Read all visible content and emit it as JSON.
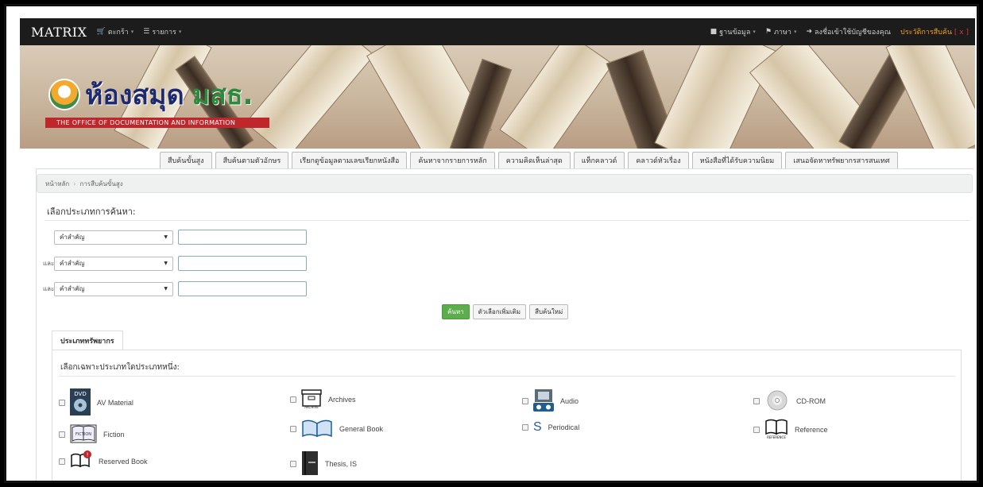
{
  "navbar": {
    "brand": "MATRIX",
    "menu_left": [
      {
        "label": "ตะกร้า",
        "icon": "cart-icon"
      },
      {
        "label": "รายการ",
        "icon": "list-icon"
      }
    ],
    "menu_right": [
      {
        "label": "ฐานข้อมูล",
        "icon": "database-icon"
      },
      {
        "label": "ภาษา",
        "icon": "flag-icon"
      },
      {
        "label": "ลงชื่อเข้าใช้บัญชีของคุณ",
        "icon": "login-icon"
      }
    ],
    "history": {
      "label": "ประวัติการสืบค้น",
      "close": "[ x ]"
    }
  },
  "banner": {
    "logo_thai": "ห้องสมุด",
    "logo_abbr": "มสธ.",
    "logo_sub": "THE OFFICE OF DOCUMENTATION AND INFORMATION"
  },
  "tabs": [
    "สืบค้นขั้นสูง",
    "สืบค้นตามตัวอักษร",
    "เรียกดูข้อมูลตามเลขเรียกหนังสือ",
    "ค้นหาจากรายการหลัก",
    "ความคิดเห็นล่าสุด",
    "แท็กคลาวด์",
    "คลาวด์หัวเรื่อง",
    "หนังสือที่ได้รับความนิยม",
    "เสนอจัดหาทรัพยากรสารสนเทศ"
  ],
  "breadcrumb": {
    "home": "หน้าหลัก",
    "sep": "›",
    "current": "การสืบค้นขั้นสูง"
  },
  "search": {
    "section_title": "เลือกประเภทการค้นหา:",
    "rows": [
      {
        "conj": "",
        "type": "คำสำคัญ",
        "value": ""
      },
      {
        "conj": "และ",
        "type": "คำสำคัญ",
        "value": ""
      },
      {
        "conj": "และ",
        "type": "คำสำคัญ",
        "value": ""
      }
    ],
    "buttons": {
      "search": "ค้นหา",
      "more": "ตัวเลือกเพิ่มเติม",
      "new": "สืบค้นใหม่"
    }
  },
  "resources": {
    "tab_label": "ประเภททรัพยากร",
    "title": "เลือกเฉพาะประเภทใดประเภทหนึ่ง:",
    "items": [
      {
        "label": "AV Material",
        "icon": "dvd-icon"
      },
      {
        "label": "Archives",
        "icon": "archive-box-icon"
      },
      {
        "label": "Audio",
        "icon": "audio-icon"
      },
      {
        "label": "CD-ROM",
        "icon": "cd-icon"
      },
      {
        "label": "Fiction",
        "icon": "fiction-book-icon"
      },
      {
        "label": "General Book",
        "icon": "open-book-icon"
      },
      {
        "label": "Periodical",
        "icon": "periodical-icon"
      },
      {
        "label": "Reference",
        "icon": "reference-book-icon"
      },
      {
        "label": "Reserved Book",
        "icon": "reserved-book-icon"
      },
      {
        "label": "Thesis, IS",
        "icon": "thesis-icon"
      }
    ]
  }
}
